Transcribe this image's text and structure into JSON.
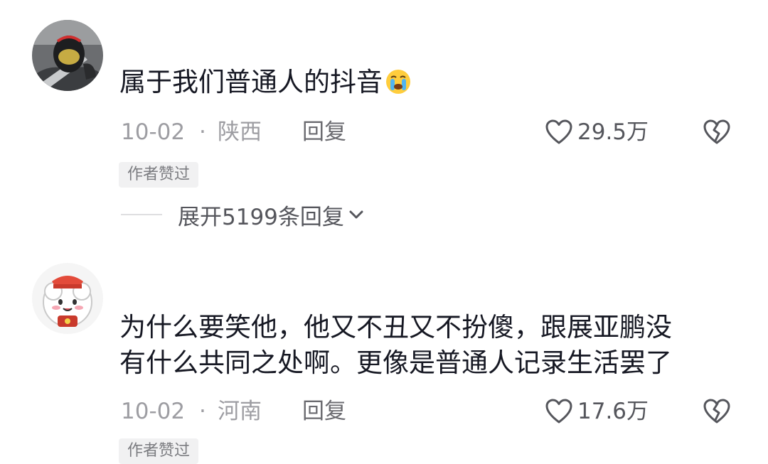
{
  "comments": [
    {
      "text_lines": [
        "属于我们普通人的抖音"
      ],
      "emoji": "crying-face-emoji",
      "date": "10-02",
      "separator": "·",
      "location": "陕西",
      "reply_label": "回复",
      "likes": "29.5万",
      "badge": "作者赞过",
      "expand_label": "展开5199条回复"
    },
    {
      "text_lines": [
        "为什么要笑他，他又不丑又不扮傻，跟展亚鹏没",
        "有什么共同之处啊。更像是普通人记录生活罢了"
      ],
      "date": "10-02",
      "separator": "·",
      "location": "河南",
      "reply_label": "回复",
      "likes": "17.6万",
      "badge": "作者赞过"
    }
  ],
  "colors": {
    "text": "#161823",
    "meta": "#9d9da2",
    "secondary": "#55565c",
    "badge_bg": "#f1f1f2"
  },
  "icons": [
    "heart-outline-icon",
    "broken-heart-icon",
    "chevron-down-icon"
  ]
}
